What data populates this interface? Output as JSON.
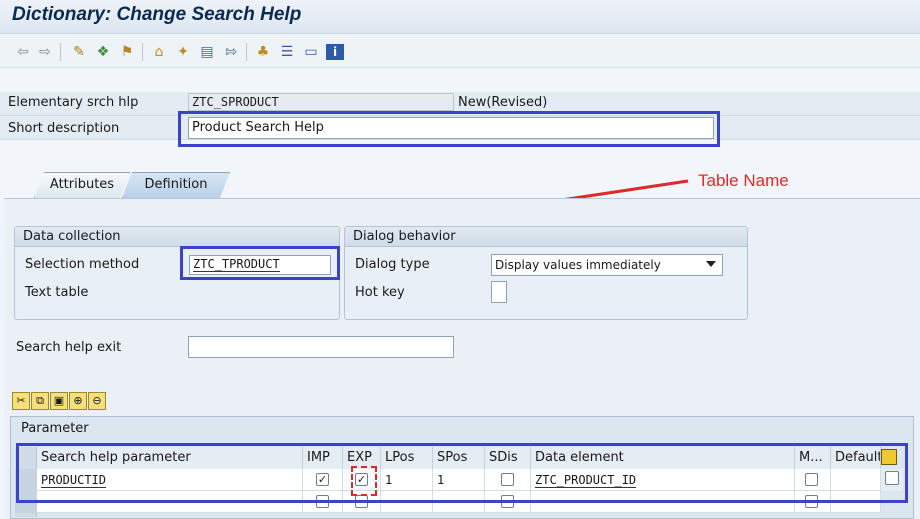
{
  "title": "Dictionary: Change Search Help",
  "toolbar": {
    "icons": [
      "back-arrow-icon",
      "forward-arrow-icon",
      "display-change-icon",
      "other-object-icon",
      "activate-icon",
      "where-used-icon",
      "magic-wand-icon",
      "object-list-icon",
      "navigate-icon",
      "hierarchy-icon",
      "list-icon",
      "layout-icon",
      "info-icon"
    ]
  },
  "header": {
    "elementary_label": "Elementary srch hlp",
    "elementary_value": "ZTC_SPRODUCT",
    "status": "New(Revised)",
    "short_desc_label": "Short description",
    "short_desc_value": "Product Search Help"
  },
  "annotation": {
    "table_name": "Table Name",
    "color": "#e0292a"
  },
  "tabs": [
    {
      "label": "Attributes",
      "active": false
    },
    {
      "label": "Definition",
      "active": true
    }
  ],
  "data_collection": {
    "title": "Data collection",
    "selection_method_label": "Selection method",
    "selection_method_value": "ZTC_TPRODUCT",
    "text_table_label": "Text table"
  },
  "dialog_behavior": {
    "title": "Dialog behavior",
    "dialog_type_label": "Dialog type",
    "dialog_type_value": "Display values immediately",
    "hot_key_label": "Hot key"
  },
  "search_help_exit_label": "Search help exit",
  "parameter": {
    "title": "Parameter",
    "columns": [
      "Search help parameter",
      "IMP",
      "EXP",
      "LPos",
      "SPos",
      "SDis",
      "Data element",
      "M...",
      "Default"
    ],
    "rows": [
      {
        "param": "PRODUCTID",
        "imp": true,
        "exp": true,
        "lpos": "1",
        "spos": "1",
        "sdis": false,
        "data_element": "ZTC_PRODUCT_ID",
        "m": false
      },
      {
        "param": "",
        "imp": false,
        "exp": false,
        "lpos": "",
        "spos": "",
        "sdis": false,
        "data_element": "",
        "m": false
      }
    ]
  },
  "colors": {
    "highlight_box": "#3a44c4",
    "accent": "#e0292a"
  }
}
